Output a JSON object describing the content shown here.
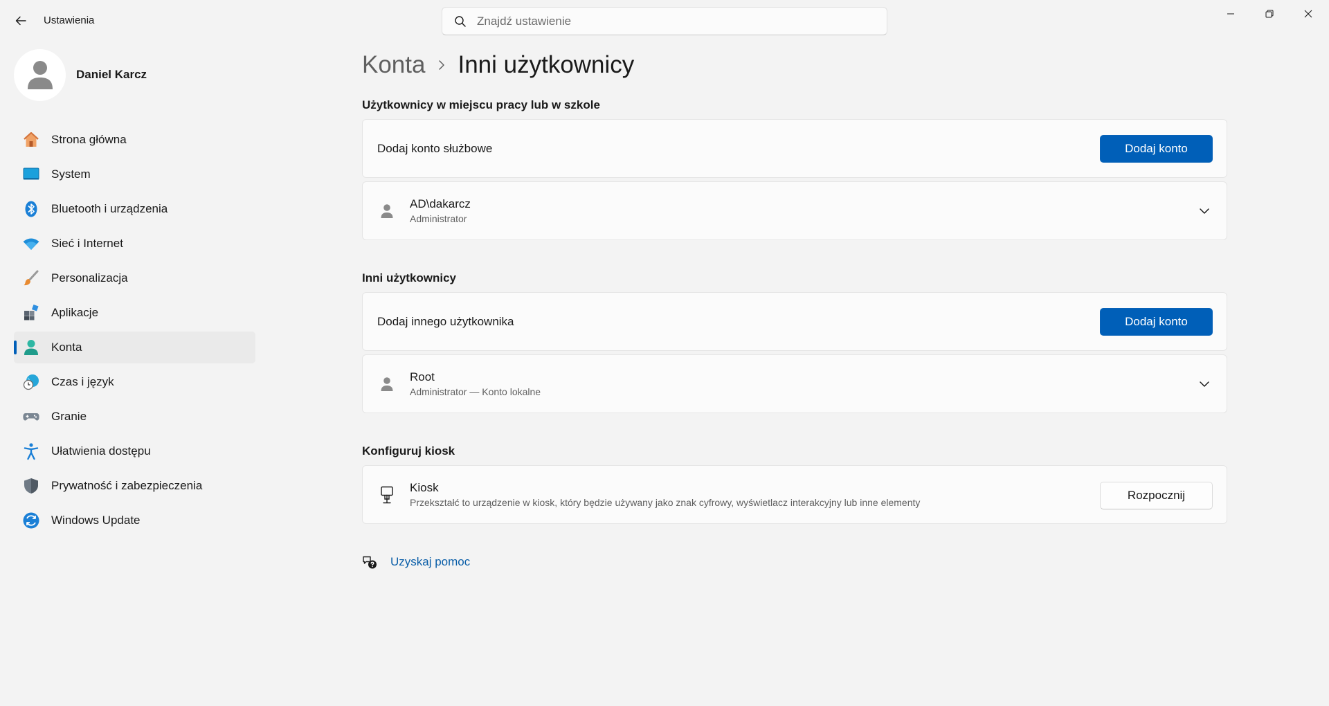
{
  "window": {
    "title": "Ustawienia",
    "controls": {
      "minimize": "minimize-icon",
      "maximize": "restore-icon",
      "close": "close-icon"
    }
  },
  "search": {
    "placeholder": "Znajdź ustawienie",
    "value": ""
  },
  "profile": {
    "name": "Daniel Karcz"
  },
  "sidebar": {
    "active": "Konta",
    "items": [
      {
        "label": "Strona główna",
        "icon": "home-icon"
      },
      {
        "label": "System",
        "icon": "display-icon"
      },
      {
        "label": "Bluetooth i urządzenia",
        "icon": "bluetooth-icon"
      },
      {
        "label": "Sieć i Internet",
        "icon": "wifi-icon"
      },
      {
        "label": "Personalizacja",
        "icon": "brush-icon"
      },
      {
        "label": "Aplikacje",
        "icon": "apps-icon"
      },
      {
        "label": "Konta",
        "icon": "account-icon"
      },
      {
        "label": "Czas i język",
        "icon": "clock-globe-icon"
      },
      {
        "label": "Granie",
        "icon": "gamepad-icon"
      },
      {
        "label": "Ułatwienia dostępu",
        "icon": "accessibility-icon"
      },
      {
        "label": "Prywatność i zabezpieczenia",
        "icon": "shield-icon"
      },
      {
        "label": "Windows Update",
        "icon": "update-icon"
      }
    ]
  },
  "breadcrumb": {
    "parent": "Konta",
    "current": "Inni użytkownicy"
  },
  "work": {
    "heading": "Użytkownicy w miejscu pracy lub w szkole",
    "add_label": "Dodaj konto służbowe",
    "add_button": "Dodaj konto",
    "account": {
      "name": "AD\\dakarcz",
      "role": "Administrator"
    }
  },
  "other": {
    "heading": "Inni użytkownicy",
    "add_label": "Dodaj innego użytkownika",
    "add_button": "Dodaj konto",
    "account": {
      "name": "Root",
      "role": "Administrator — Konto lokalne"
    }
  },
  "kiosk": {
    "heading": "Konfiguruj kiosk",
    "title": "Kiosk",
    "description": "Przekształć to urządzenie w kiosk, który będzie używany jako znak cyfrowy, wyświetlacz interakcyjny lub inne elementy",
    "button": "Rozpocznij"
  },
  "help": {
    "label": "Uzyskaj pomoc"
  },
  "colors": {
    "accent": "#005fb8",
    "background": "#f3f3f3",
    "card": "#fbfbfb",
    "link": "#0a5ea8"
  }
}
